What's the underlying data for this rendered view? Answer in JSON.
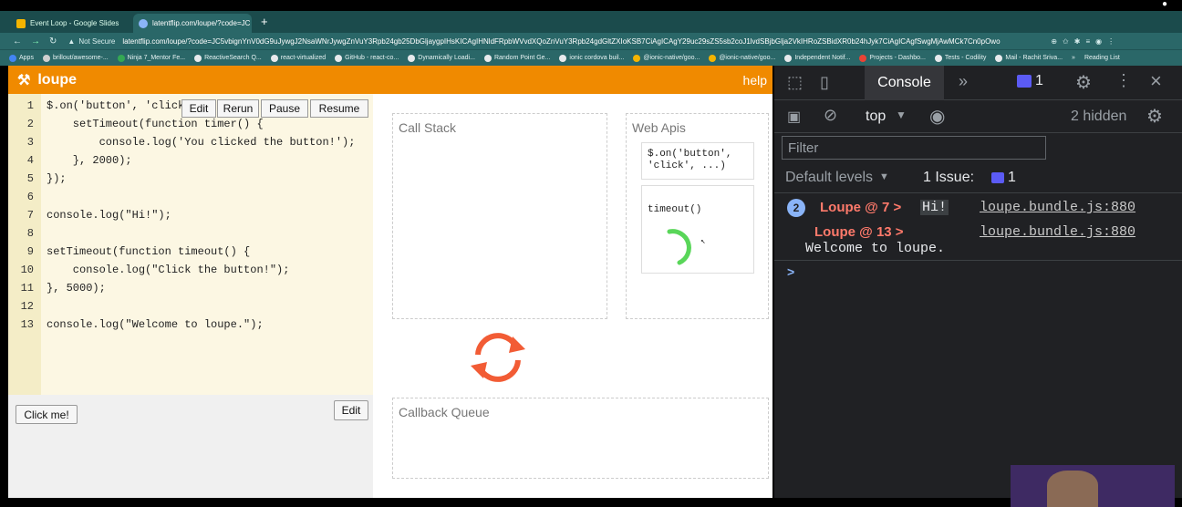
{
  "browser": {
    "tabs": [
      {
        "label": "Event Loop - Google Slides",
        "favicon_color": "#f4b400"
      },
      {
        "label": "latentflip.com/loupe/?code=JC",
        "favicon_color": "#8ab4f8"
      }
    ],
    "not_secure": "Not Secure",
    "url": "latentflip.com/loupe/?code=JC5vbignYnV0dG9uJywgJ2NsaWNrJywgZnVuY3Rpb24gb25DbGljaygpIHsKICAgIHNldFRpbWVvdXQoZnVuY3Rpb24gdGltZXIoKSB7CiAgICAgY29uc29sZS5sb2coJ1lvdSBjbGlja2VkIHRoZSBidXR0b24hJyk7CiAgICAgfSwgMjAwMCk7Cn0pOwo",
    "bookmarks": [
      "Apps",
      "brillout/awesome-...",
      "Ninja 7_Mentor Fe...",
      "ReactiveSearch Q...",
      "react-virtualized",
      "GitHub - react-co...",
      "Dynamically Loadi...",
      "Random Point Ge...",
      "ionic cordova buil...",
      "@ionic-native/goo...",
      "@ionic-native/goo...",
      "Independent Notif...",
      "Projects - Dashbo...",
      "Tests - Codility",
      "Mail - Rachit Sriva...",
      "»",
      "Reading List"
    ]
  },
  "loupe": {
    "title": "loupe",
    "help": "help",
    "buttons": {
      "edit": "Edit",
      "rerun": "Rerun",
      "pause": "Pause",
      "resume": "Resume",
      "edit_html": "Edit",
      "click_me": "Click me!"
    },
    "code_lines": [
      {
        "n": "1",
        "text": "$.on('button', 'click"
      },
      {
        "n": "2",
        "text": "    setTimeout(function timer() {"
      },
      {
        "n": "3",
        "text": "        console.log('You clicked the button!');"
      },
      {
        "n": "4",
        "text": "    }, 2000);"
      },
      {
        "n": "5",
        "text": "});"
      },
      {
        "n": "6",
        "text": ""
      },
      {
        "n": "7",
        "text": "console.log(\"Hi!\");"
      },
      {
        "n": "8",
        "text": ""
      },
      {
        "n": "9",
        "text": "setTimeout(function timeout() {"
      },
      {
        "n": "10",
        "text": "    console.log(\"Click the button!\");"
      },
      {
        "n": "11",
        "text": "}, 5000);"
      },
      {
        "n": "12",
        "text": ""
      },
      {
        "n": "13",
        "text": "console.log(\"Welcome to loupe.\");"
      }
    ],
    "call_stack_label": "Call Stack",
    "web_apis_label": "Web Apis",
    "web_api_click_line1": "$.on('button',",
    "web_api_click_line2": "'click', ...)",
    "web_api_timeout": "timeout()",
    "callback_queue_label": "Callback Queue",
    "accent": "#f08a00"
  },
  "devtools": {
    "console_tab": "Console",
    "issue_badge": "1",
    "context": "top",
    "hidden": "2 hidden",
    "filter_placeholder": "Filter",
    "default_levels": "Default levels",
    "issues_label": "1 Issue:",
    "issues_count": "1",
    "logs": [
      {
        "count": "2",
        "prefix": "Loupe @ 7 > ",
        "message": "Hi!",
        "source": "loupe.bundle.js:880"
      },
      {
        "prefix": "Loupe @ 13 > ",
        "message": "Welcome to loupe.",
        "source": "loupe.bundle.js:880"
      }
    ],
    "prompt": ">"
  }
}
